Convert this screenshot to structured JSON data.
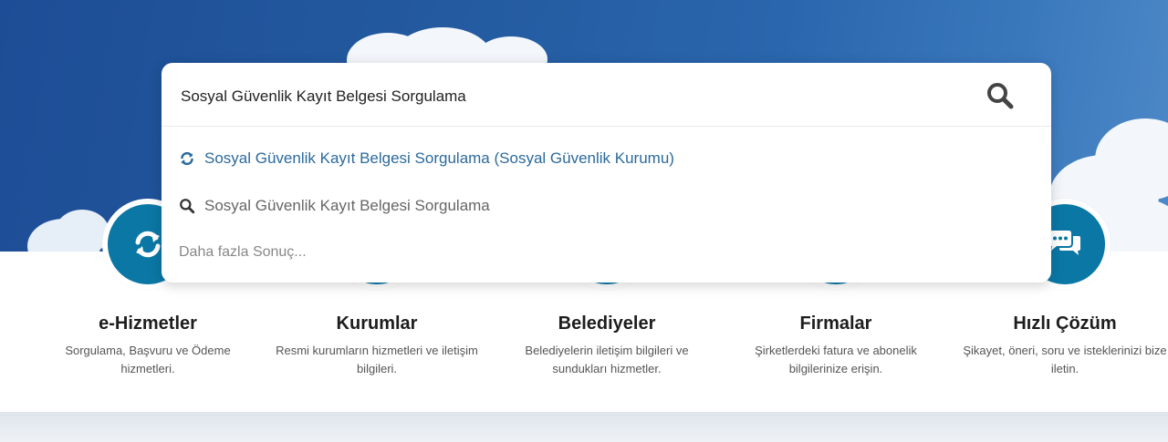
{
  "search": {
    "query": "Sosyal Güvenlik Kayıt Belgesi Sorgulama",
    "button_icon": "search-icon",
    "suggestions": [
      {
        "label": "Sosyal Güvenlik Kayıt Belgesi Sorgulama (Sosyal Güvenlik Kurumu)",
        "icon": "refresh-icon",
        "color": "#2b6a9c"
      },
      {
        "label": "Sosyal Güvenlik Kayıt Belgesi Sorgulama",
        "icon": "search-icon",
        "color": "#666666"
      },
      {
        "label": "Daha fazla Sonuç...",
        "icon": "",
        "color": "#888888"
      }
    ]
  },
  "categories": [
    {
      "title": "e-Hizmetler",
      "description": "Sorgulama, Başvuru ve Ödeme hizmetleri.",
      "icon": "refresh-icon"
    },
    {
      "title": "Kurumlar",
      "description": "Resmi kurumların hizmetleri ve iletişim bilgileri.",
      "icon": "building-icon"
    },
    {
      "title": "Belediyeler",
      "description": "Belediyelerin iletişim bilgileri ve sundukları hizmetler.",
      "icon": "municipality-icon"
    },
    {
      "title": "Firmalar",
      "description": "Şirketlerdeki fatura ve abonelik bilgilerinize erişin.",
      "icon": "company-icon"
    },
    {
      "title": "Hızlı Çözüm",
      "description": "Şikayet, öneri, soru ve isteklerinizi bize iletin.",
      "icon": "chat-bubbles-icon"
    }
  ],
  "colors": {
    "accent": "#0b77a5",
    "link": "#2b6a9c",
    "sky": "#23599f"
  }
}
